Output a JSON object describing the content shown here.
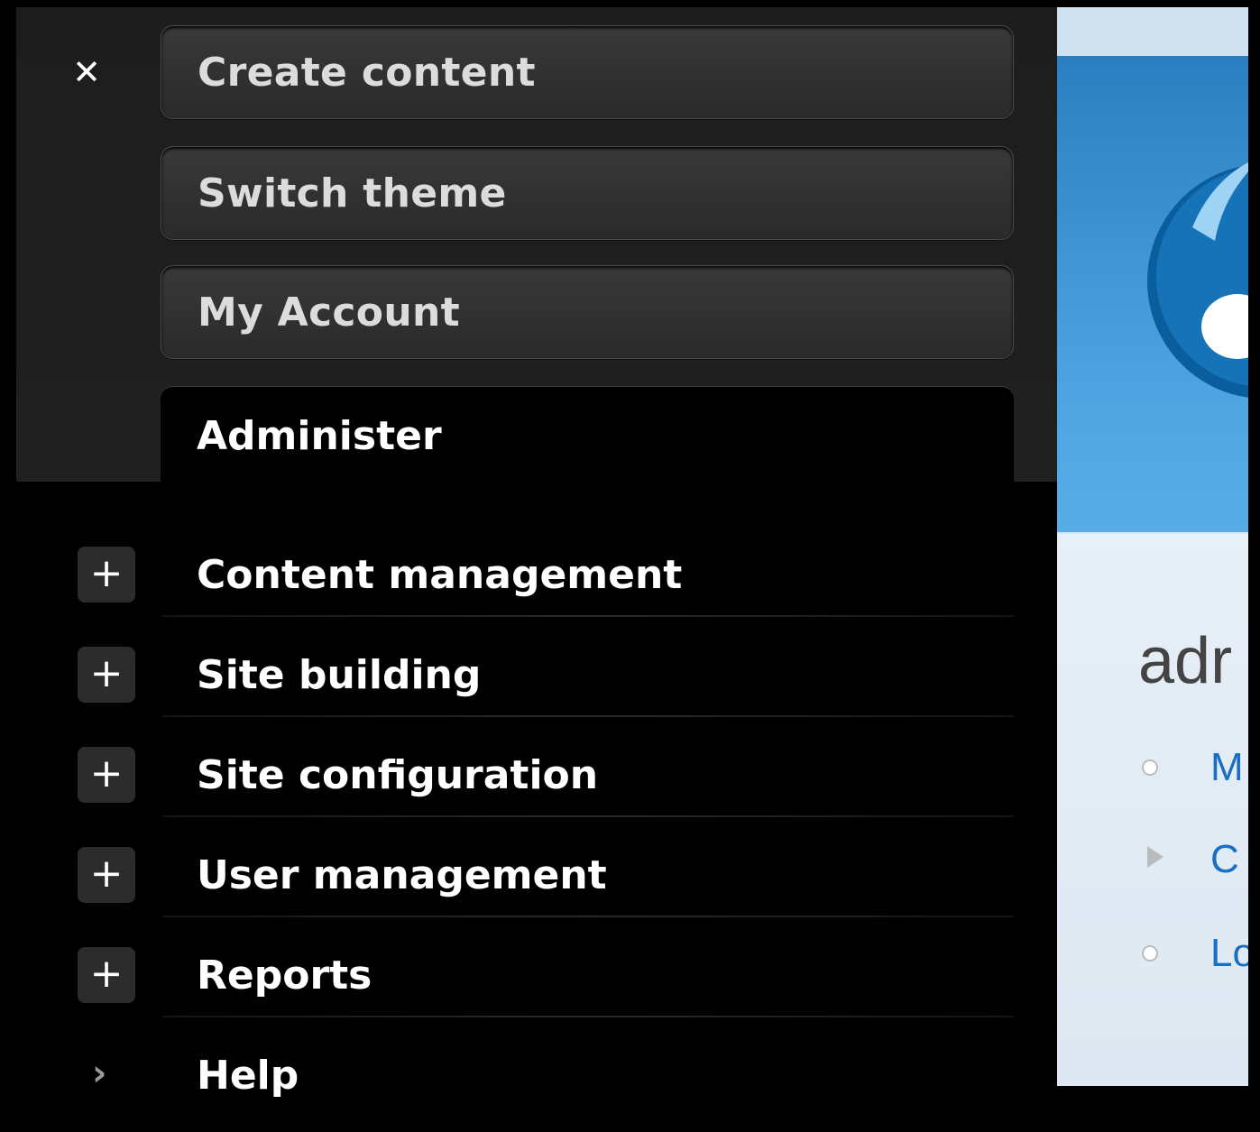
{
  "toolbar": {
    "close_icon": "✕",
    "tabs": [
      {
        "label": "Create content"
      },
      {
        "label": "Switch theme"
      },
      {
        "label": "My Account"
      }
    ],
    "active_tab": "Administer"
  },
  "admin_menu": {
    "items": [
      {
        "label": "Content management",
        "expander": "+"
      },
      {
        "label": "Site building",
        "expander": "+"
      },
      {
        "label": "Site configuration",
        "expander": "+"
      },
      {
        "label": "User management",
        "expander": "+"
      },
      {
        "label": "Reports",
        "expander": "+"
      },
      {
        "label": "Help",
        "expander": "›"
      }
    ]
  },
  "site": {
    "title_partial": "adr",
    "links": [
      "M",
      "C",
      "Lo"
    ]
  },
  "colors": {
    "panel_bg": "#000000",
    "tab_bg": "#333333",
    "link_blue": "#1a6fc4",
    "header_blue": "#2a7fc0"
  }
}
